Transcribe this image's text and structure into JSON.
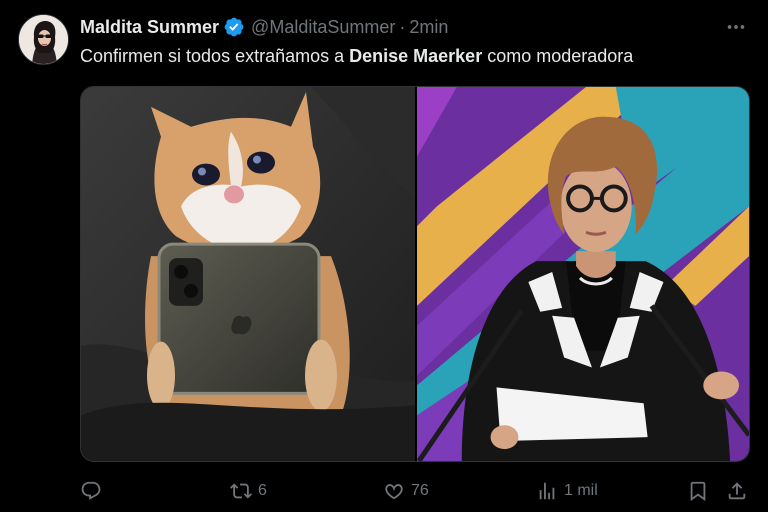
{
  "author": {
    "display_name": "Maldita Summer",
    "handle": "@MalditaSummer",
    "time": "2min",
    "verified": true
  },
  "tweet": {
    "text_before": "Confirmen si todos extrañamos a ",
    "text_bold": "Denise Maerker",
    "text_after": " como moderadora"
  },
  "media": {
    "left_image": "crying-cat-holding-phone",
    "right_image": "moderator-at-podium"
  },
  "actions": {
    "reply_icon": "reply-icon",
    "retweet_count": "6",
    "like_count": "76",
    "views_count": "1 mil",
    "bookmark_icon": "bookmark-icon",
    "share_icon": "share-icon"
  },
  "colors": {
    "background": "#000000",
    "text": "#e7e9ea",
    "secondary_text": "#71767b",
    "verified_blue": "#1d9bf0"
  }
}
